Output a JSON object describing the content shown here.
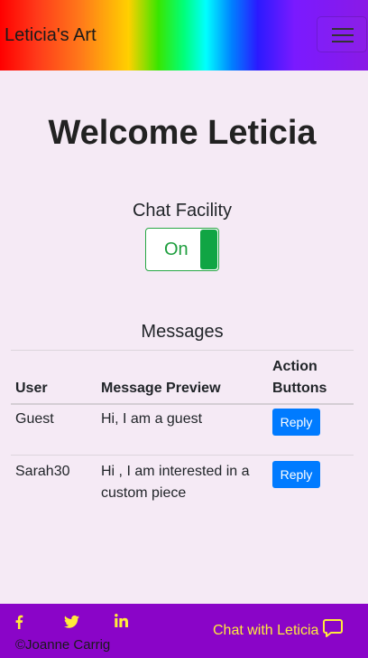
{
  "navbar": {
    "brand": "Leticia's Art",
    "menu_icon": "hamburger-icon"
  },
  "main": {
    "welcome": "Welcome Leticia",
    "chat_facility": {
      "label": "Chat Facility",
      "toggle_text": "On",
      "state": "on"
    },
    "messages": {
      "title": "Messages",
      "headers": {
        "user": "User",
        "preview": "Message Preview",
        "action_line1": "Action",
        "action_line2": "Buttons"
      },
      "rows": [
        {
          "user": "Guest",
          "preview_line1": "Hi, I am a guest",
          "preview_line2": "",
          "action": "Reply"
        },
        {
          "user": "Sarah30",
          "preview_line1": "Hi , I am interested in a",
          "preview_line2": "custom piece",
          "action": "Reply"
        }
      ]
    }
  },
  "footer": {
    "social_icons": [
      "facebook-icon",
      "twitter-icon",
      "linkedin-icon"
    ],
    "copyright": "©Joanne Carrig",
    "chat_link": "Chat with Leticia",
    "chat_icon": "chat-bubble-icon"
  },
  "colors": {
    "background": "#f5eaf5",
    "footer": "#8a05c8",
    "accent_yellow": "#ffeb3b",
    "reply_button": "#007bff",
    "toggle_green": "#10a544"
  }
}
